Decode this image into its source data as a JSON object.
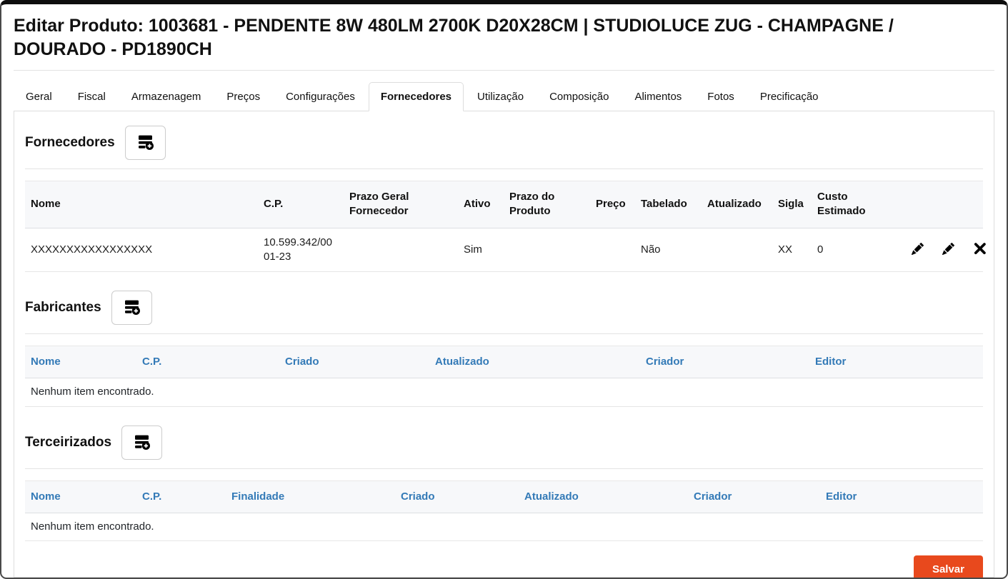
{
  "window": {
    "title": "Editar Produto: 1003681 - PENDENTE 8W 480LM 2700K D20X28CM | STUDIOLUCE ZUG - CHAMPAGNE / DOURADO - PD1890CH"
  },
  "tabs": [
    {
      "label": "Geral",
      "active": false
    },
    {
      "label": "Fiscal",
      "active": false
    },
    {
      "label": "Armazenagem",
      "active": false
    },
    {
      "label": "Preços",
      "active": false
    },
    {
      "label": "Configurações",
      "active": false
    },
    {
      "label": "Fornecedores",
      "active": true
    },
    {
      "label": "Utilização",
      "active": false
    },
    {
      "label": "Composição",
      "active": false
    },
    {
      "label": "Alimentos",
      "active": false
    },
    {
      "label": "Fotos",
      "active": false
    },
    {
      "label": "Precificação",
      "active": false
    }
  ],
  "sections": {
    "fornecedores": {
      "heading": "Fornecedores",
      "columns": [
        "Nome",
        "C.P.",
        "Prazo Geral Fornecedor",
        "Ativo",
        "Prazo do Produto",
        "Preço",
        "Tabelado",
        "Atualizado",
        "Sigla",
        "Custo Estimado"
      ],
      "row": {
        "nome": "XXXXXXXXXXXXXXXXX",
        "cp": "10.599.342/0001-23",
        "prazo_geral_fornecedor": "",
        "ativo": "Sim",
        "prazo_do_produto": "",
        "preco": "",
        "tabelado": "Não",
        "atualizado": "",
        "sigla": "XX",
        "custo_estimado": "0"
      },
      "row_actions": [
        "edit",
        "edit",
        "delete"
      ]
    },
    "fabricantes": {
      "heading": "Fabricantes",
      "columns": [
        "Nome",
        "C.P.",
        "Criado",
        "Atualizado",
        "Criador",
        "Editor"
      ],
      "empty_message": "Nenhum item encontrado."
    },
    "terceirizados": {
      "heading": "Terceirizados",
      "columns": [
        "Nome",
        "C.P.",
        "Finalidade",
        "Criado",
        "Atualizado",
        "Criador",
        "Editor"
      ],
      "empty_message": "Nenhum item encontrado."
    }
  },
  "footer": {
    "save_label": "Salvar"
  },
  "colors": {
    "accent_button": "#e8491d",
    "sortable_header_link": "#337ab7",
    "tab_border": "#dddddd",
    "table_header_bg": "#f7f8fa"
  }
}
